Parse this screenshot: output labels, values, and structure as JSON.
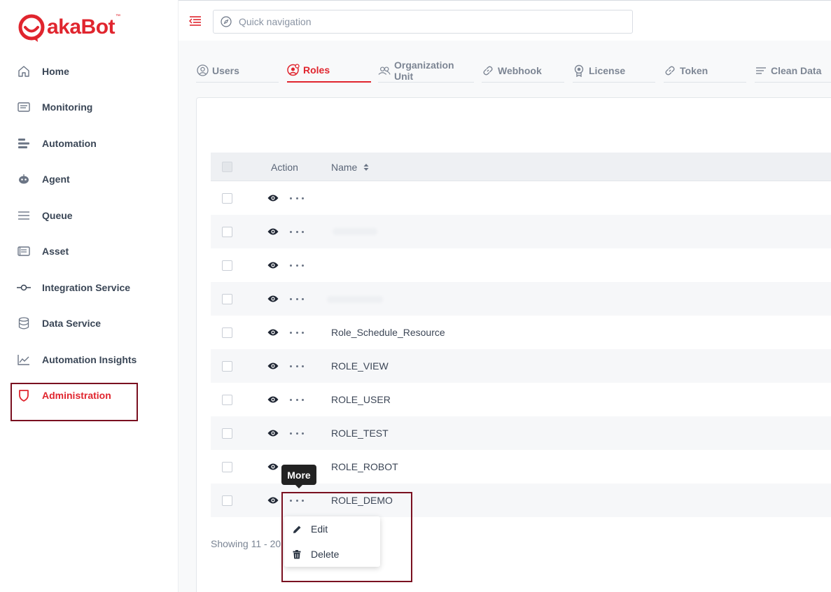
{
  "app": {
    "brand_text": "akaBot",
    "brand_tm": "™",
    "brand_color": "#e0252e"
  },
  "sidebar": {
    "items": [
      {
        "label": "Home",
        "icon": "home-icon"
      },
      {
        "label": "Monitoring",
        "icon": "monitor-icon"
      },
      {
        "label": "Automation",
        "icon": "automation-icon"
      },
      {
        "label": "Agent",
        "icon": "agent-icon"
      },
      {
        "label": "Queue",
        "icon": "queue-icon"
      },
      {
        "label": "Asset",
        "icon": "asset-icon"
      },
      {
        "label": "Integration Service",
        "icon": "integration-icon"
      },
      {
        "label": "Data Service",
        "icon": "database-icon"
      },
      {
        "label": "Automation Insights",
        "icon": "chart-icon"
      },
      {
        "label": "Administration",
        "icon": "shield-icon",
        "active": true
      }
    ]
  },
  "header": {
    "search_placeholder": "Quick navigation"
  },
  "tabs": [
    {
      "label": "Users",
      "icon": "user-circle-icon"
    },
    {
      "label": "Roles",
      "icon": "role-icon",
      "active": true
    },
    {
      "label": "Organization Unit",
      "icon": "org-unit-icon"
    },
    {
      "label": "Webhook",
      "icon": "link-icon"
    },
    {
      "label": "License",
      "icon": "license-icon"
    },
    {
      "label": "Token",
      "icon": "link-icon"
    },
    {
      "label": "Clean Data",
      "icon": "clean-icon"
    }
  ],
  "table": {
    "columns": {
      "action": "Action",
      "name": "Name"
    },
    "rows": [
      {
        "name": ""
      },
      {
        "name": ""
      },
      {
        "name": ""
      },
      {
        "name": ""
      },
      {
        "name": "Role_Schedule_Resource"
      },
      {
        "name": "ROLE_VIEW"
      },
      {
        "name": "ROLE_USER"
      },
      {
        "name": "ROLE_TEST"
      },
      {
        "name": "ROLE_ROBOT"
      },
      {
        "name": "ROLE_DEMO"
      }
    ],
    "footer_text": "Showing 11 - 20"
  },
  "tooltip": {
    "text": "More"
  },
  "context_menu": {
    "edit_label": "Edit",
    "delete_label": "Delete"
  }
}
